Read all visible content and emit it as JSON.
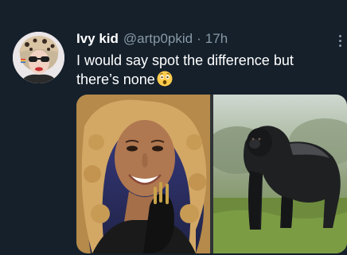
{
  "tweet": {
    "display_name": "Ivy kid",
    "handle": "@artp0pkid",
    "separator": "·",
    "time": "17h",
    "text": "I would say spot the difference but there’s none",
    "emoji_icon": "astonished-face-emoji"
  },
  "media": {
    "image_count": 2,
    "left_image": "woman-with-curly-hair-photo",
    "right_image": "gorilla-photo"
  },
  "colors": {
    "background": "#15202b",
    "text": "#ffffff",
    "secondary_text": "#8899a6"
  }
}
